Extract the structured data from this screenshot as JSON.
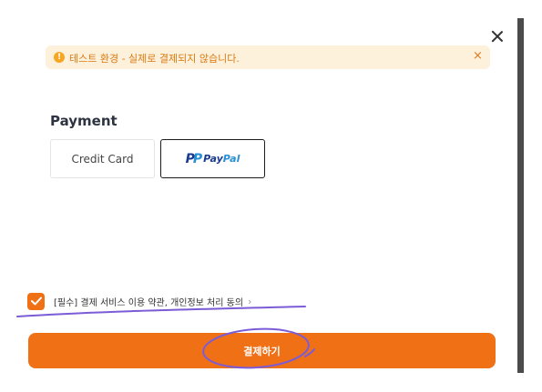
{
  "alert": {
    "icon": "warning-icon",
    "text": "테스트 환경 - 실제로 결제되지 않습니다.",
    "close_symbol": "×"
  },
  "payment": {
    "title": "Payment",
    "methods": [
      {
        "label": "Credit Card",
        "selected": false
      },
      {
        "label": "PayPal",
        "selected": true,
        "logo_text_pay": "Pay",
        "logo_text_pal": "Pal"
      }
    ]
  },
  "agreement": {
    "checked": true,
    "text": "[필수] 결제 서비스 이용 약관, 개인정보 처리 동의",
    "chevron": "›"
  },
  "submit": {
    "label": "결제하기"
  },
  "colors": {
    "accent": "#f07016",
    "alert_bg": "#fdf1dc",
    "alert_text": "#d97a12",
    "paypal_dark": "#1a3b8f",
    "paypal_light": "#2790d5",
    "annotation": "#7b5cd6"
  }
}
